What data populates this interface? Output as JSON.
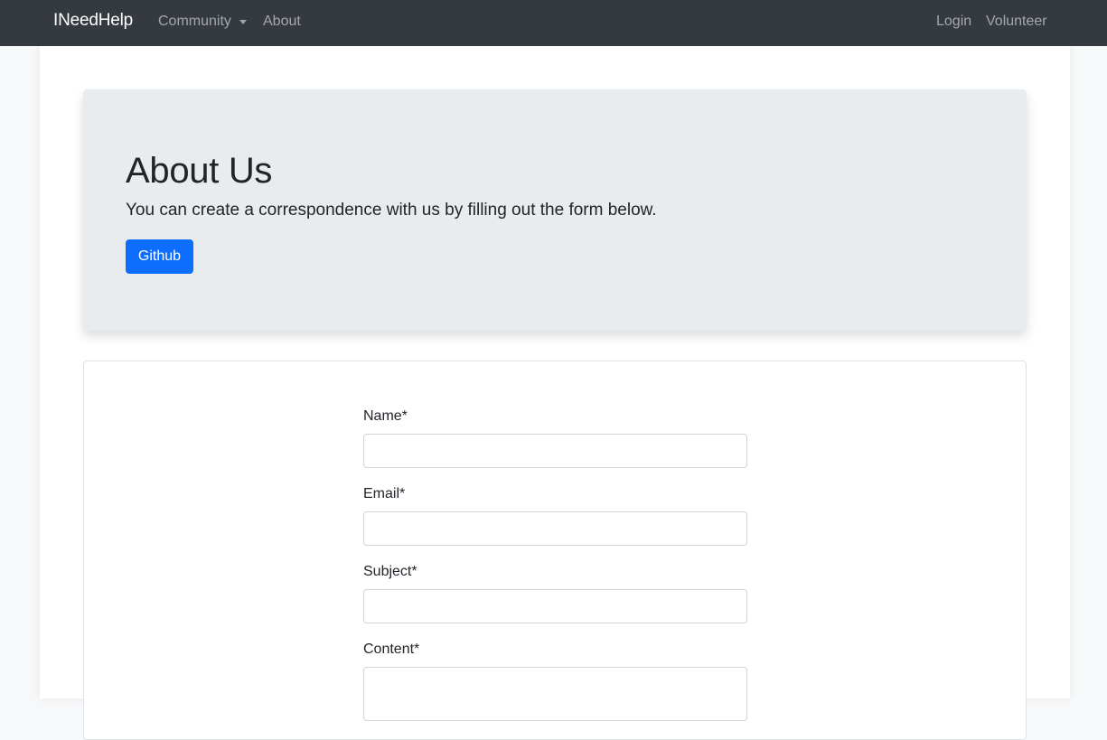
{
  "navbar": {
    "brand": "INeedHelp",
    "links": {
      "community": "Community",
      "about": "About",
      "login": "Login",
      "volunteer": "Volunteer"
    }
  },
  "jumbotron": {
    "title": "About Us",
    "lead": "You can create a correspondence with us by filling out the form below.",
    "button_label": "Github"
  },
  "form": {
    "fields": {
      "name": {
        "label": "Name*",
        "value": ""
      },
      "email": {
        "label": "Email*",
        "value": ""
      },
      "subject": {
        "label": "Subject*",
        "value": ""
      },
      "content": {
        "label": "Content*",
        "value": ""
      }
    }
  },
  "colors": {
    "navbar_bg": "#343a40",
    "jumbotron_bg": "#e9ecef",
    "primary": "#0d6efd"
  }
}
